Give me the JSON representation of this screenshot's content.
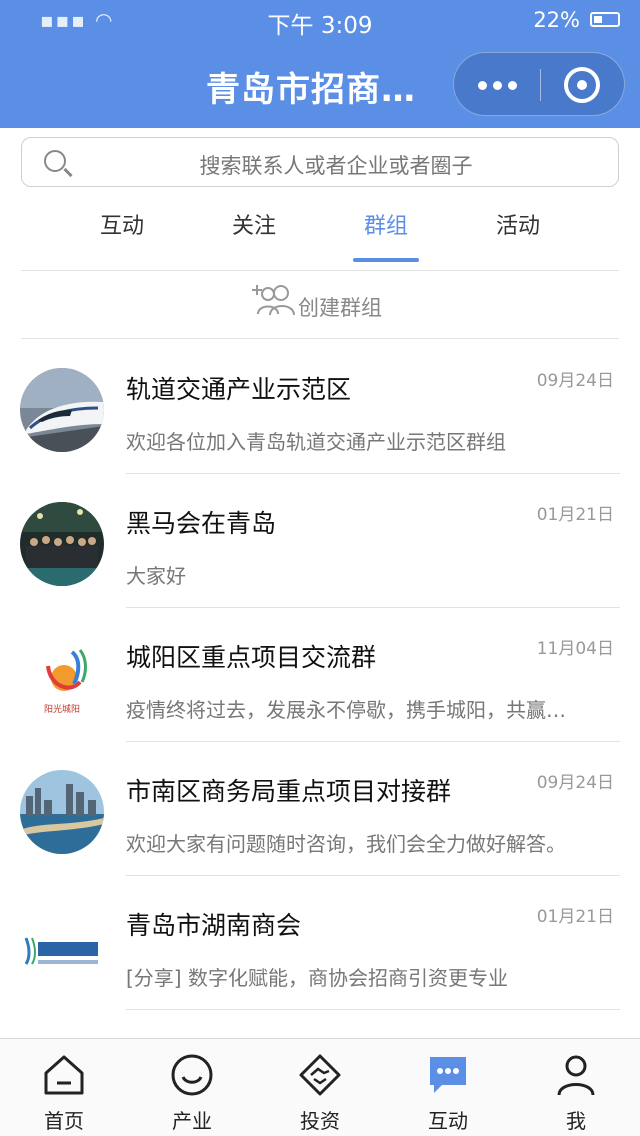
{
  "status_bar": {
    "time": "下午 3:09",
    "battery": "22%"
  },
  "header": {
    "title": "青岛市招商…"
  },
  "search": {
    "placeholder": "搜索联系人或者企业或者圈子"
  },
  "tabs": [
    {
      "label": "互动"
    },
    {
      "label": "关注"
    },
    {
      "label": "群组",
      "active": true
    },
    {
      "label": "活动"
    }
  ],
  "create_group": {
    "label": "创建群组"
  },
  "groups": [
    {
      "name": "轨道交通产业示范区",
      "date": "09月24日",
      "message": "欢迎各位加入青岛轨道交通产业示范区群组",
      "avatar": "train-avatar"
    },
    {
      "name": "黑马会在青岛",
      "date": "01月21日",
      "message": "大家好",
      "avatar": "crowd-photo-avatar"
    },
    {
      "name": "城阳区重点项目交流群",
      "date": "11月04日",
      "message": "疫情终将过去，发展永不停歇，携手城阳，共赢…",
      "avatar": "chengyang-logo-avatar"
    },
    {
      "name": "市南区商务局重点项目对接群",
      "date": "09月24日",
      "message": "欢迎大家有问题随时咨询，我们会全力做好解答。",
      "avatar": "city-skyline-avatar"
    },
    {
      "name": "青岛市湖南商会",
      "date": "01月21日",
      "message": "[分享] 数字化赋能，商协会招商引资更专业",
      "avatar": "hunan-chamber-logo-avatar"
    }
  ],
  "bottom_nav": [
    {
      "label": "首页",
      "icon": "home-icon"
    },
    {
      "label": "产业",
      "icon": "smile-icon"
    },
    {
      "label": "投资",
      "icon": "handshake-icon"
    },
    {
      "label": "互动",
      "icon": "chat-icon",
      "active": true
    },
    {
      "label": "我",
      "icon": "person-icon"
    }
  ],
  "colors": {
    "brand": "#5b8fe6",
    "active_tab": "#5b8fe6"
  }
}
